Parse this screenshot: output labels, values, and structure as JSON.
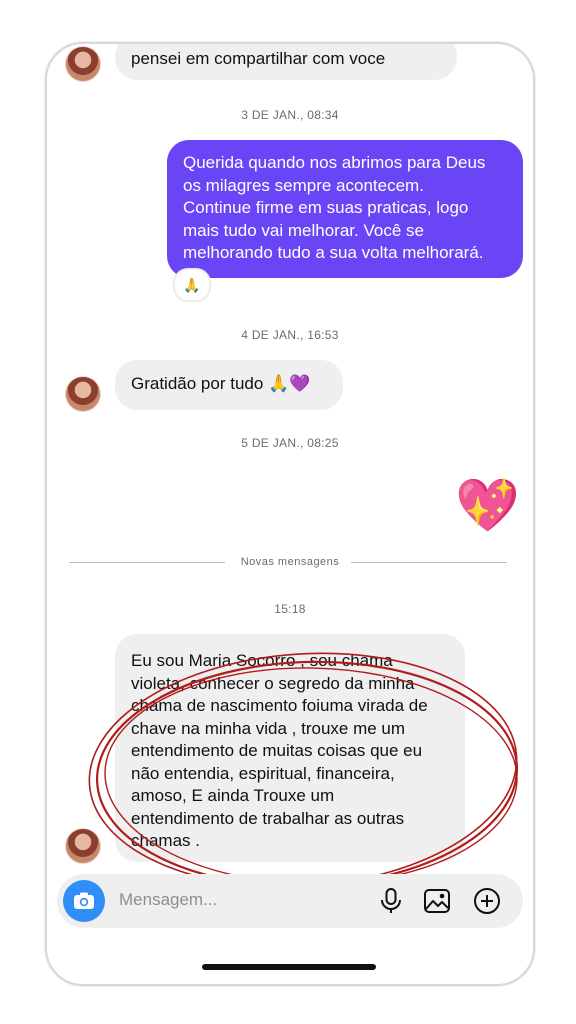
{
  "chat": {
    "top_message": "pensei em compartilhar  com voce",
    "ts1": "3 DE JAN., 08:34",
    "sent_message_lines": [
      "Querida quando nos abrimos para Deus",
      "os milagres sempre acontecem.",
      "Continue firme em suas praticas, logo",
      "mais tudo vai melhorar. Você se",
      "melhorando tudo a sua volta melhorará."
    ],
    "sent_reaction": "🙏",
    "ts2": "4 DE JAN., 16:53",
    "gratidao_message": "Gratidão por tudo 🙏💜",
    "ts3": "5 DE JAN., 08:25",
    "heart_sticker": "💖",
    "divider_label": "Novas mensagens",
    "ts4": "15:18",
    "last_message_lines": [
      "Eu sou Maria Socorro , sou chama",
      "violeta,  conhecer o segredo da minha",
      "chama de nascimento foiuma virada de",
      "chave na minha vida , trouxe me um",
      "entendimento  de muitas coisas que eu",
      "não entendia, espiritual,  financeira,",
      "amoso,  E ainda Trouxe  um",
      "entendimento  de trabalhar as outras",
      "chamas ."
    ]
  },
  "composer": {
    "placeholder": "Mensagem...",
    "icons": [
      "camera-icon",
      "microphone-icon",
      "gallery-icon",
      "plus-circle-icon"
    ]
  },
  "colors": {
    "sent_bubble": "#6a45f5",
    "received_bubble": "#efefef",
    "camera_button": "#2f8ef7",
    "annotation": "#b01c1c"
  }
}
